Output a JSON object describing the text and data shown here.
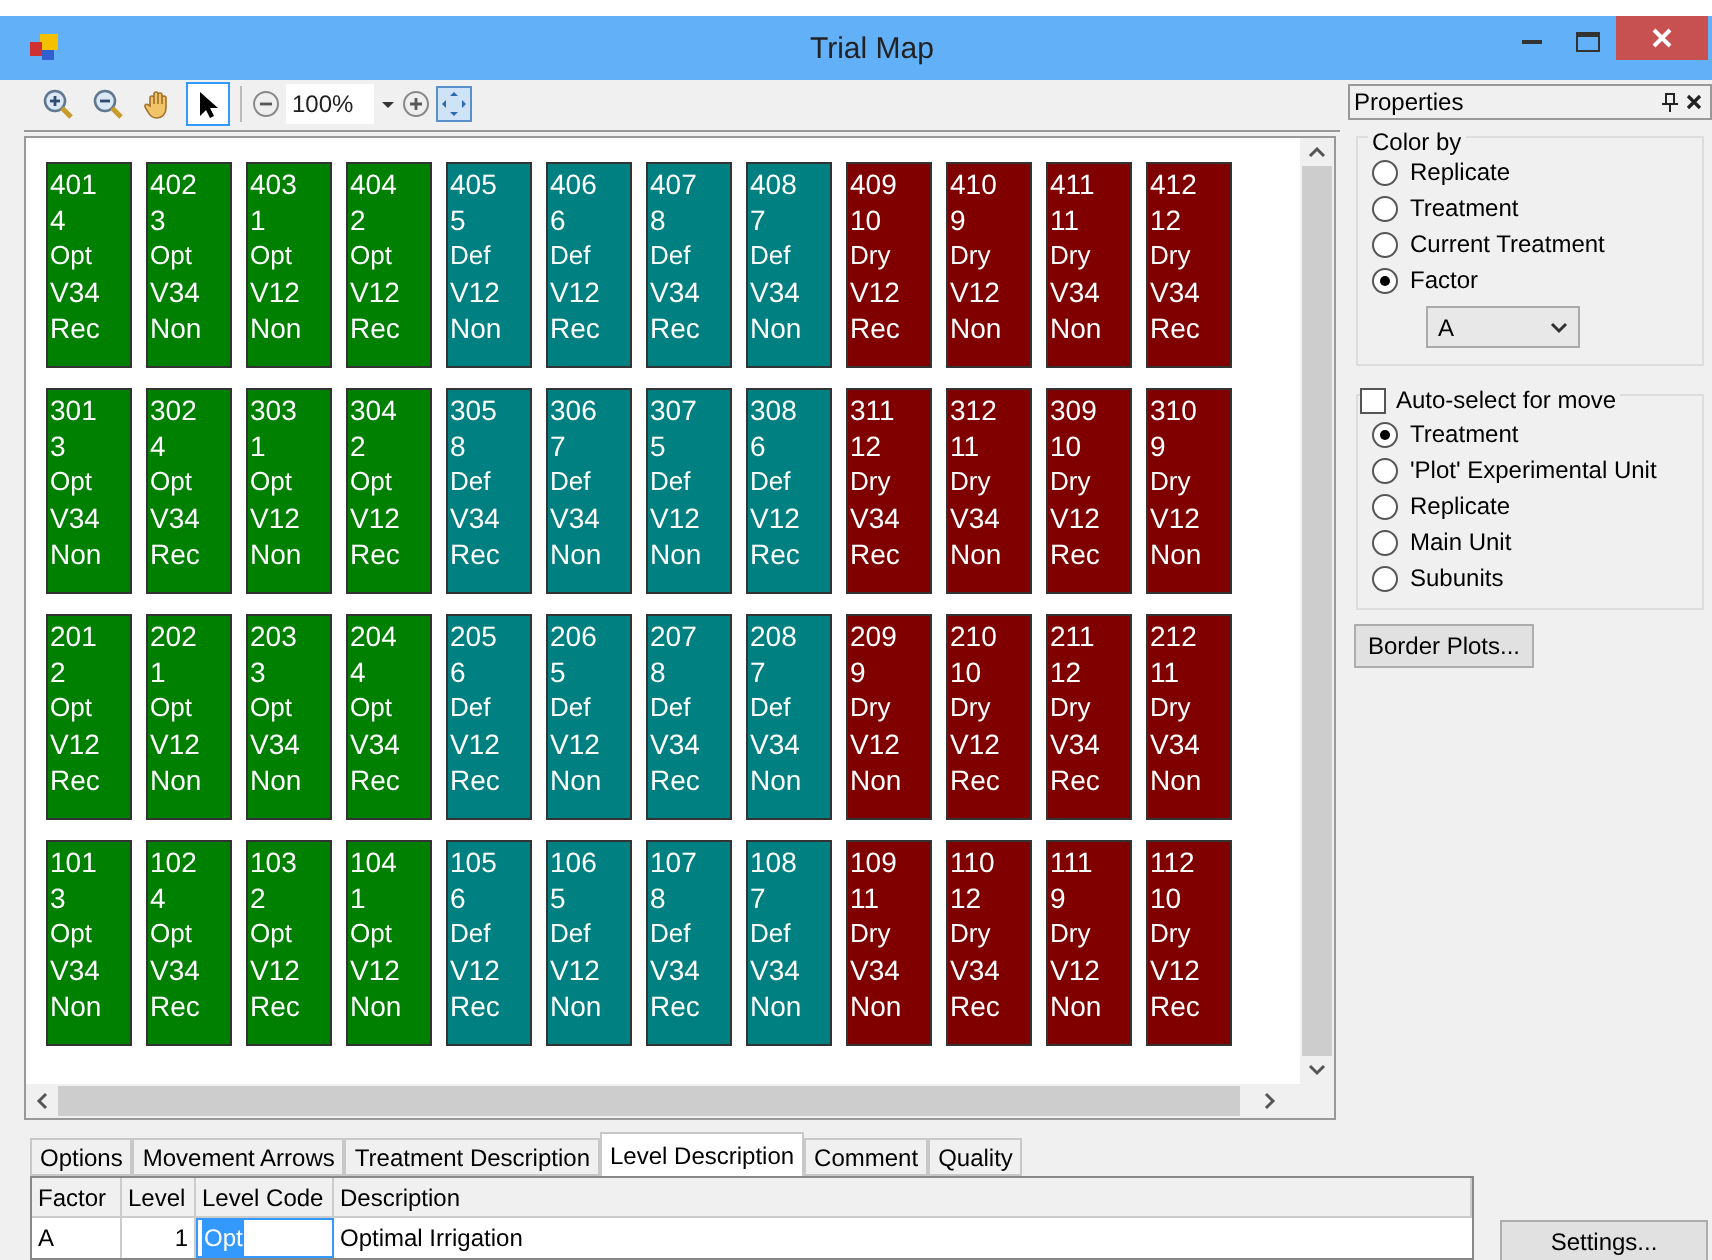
{
  "window": {
    "title": "Trial Map"
  },
  "toolbar": {
    "tools": [
      {
        "kind": "zoom-in",
        "selected": false
      },
      {
        "kind": "zoom-out",
        "selected": false
      },
      {
        "kind": "pan",
        "selected": false
      },
      {
        "kind": "pointer",
        "selected": true
      }
    ],
    "zoom": "100%"
  },
  "map": {
    "rows": [
      [
        {
          "plot": "401",
          "treatment": "4",
          "line_1": "Opt",
          "line_2": "V34",
          "line_3": "Rec",
          "color": "#008000"
        },
        {
          "plot": "402",
          "treatment": "3",
          "line_1": "Opt",
          "line_2": "V34",
          "line_3": "Non",
          "color": "#008000"
        },
        {
          "plot": "403",
          "treatment": "1",
          "line_1": "Opt",
          "line_2": "V12",
          "line_3": "Non",
          "color": "#008000"
        },
        {
          "plot": "404",
          "treatment": "2",
          "line_1": "Opt",
          "line_2": "V12",
          "line_3": "Rec",
          "color": "#008000"
        },
        {
          "plot": "405",
          "treatment": "5",
          "line_1": "Def",
          "line_2": "V12",
          "line_3": "Non",
          "color": "#008080"
        },
        {
          "plot": "406",
          "treatment": "6",
          "line_1": "Def",
          "line_2": "V12",
          "line_3": "Rec",
          "color": "#008080"
        },
        {
          "plot": "407",
          "treatment": "8",
          "line_1": "Def",
          "line_2": "V34",
          "line_3": "Rec",
          "color": "#008080"
        },
        {
          "plot": "408",
          "treatment": "7",
          "line_1": "Def",
          "line_2": "V34",
          "line_3": "Non",
          "color": "#008080"
        },
        {
          "plot": "409",
          "treatment": "10",
          "line_1": "Dry",
          "line_2": "V12",
          "line_3": "Rec",
          "color": "#800000"
        },
        {
          "plot": "410",
          "treatment": "9",
          "line_1": "Dry",
          "line_2": "V12",
          "line_3": "Non",
          "color": "#800000"
        },
        {
          "plot": "411",
          "treatment": "11",
          "line_1": "Dry",
          "line_2": "V34",
          "line_3": "Non",
          "color": "#800000"
        },
        {
          "plot": "412",
          "treatment": "12",
          "line_1": "Dry",
          "line_2": "V34",
          "line_3": "Rec",
          "color": "#800000"
        }
      ],
      [
        {
          "plot": "301",
          "treatment": "3",
          "line_1": "Opt",
          "line_2": "V34",
          "line_3": "Non",
          "color": "#008000"
        },
        {
          "plot": "302",
          "treatment": "4",
          "line_1": "Opt",
          "line_2": "V34",
          "line_3": "Rec",
          "color": "#008000"
        },
        {
          "plot": "303",
          "treatment": "1",
          "line_1": "Opt",
          "line_2": "V12",
          "line_3": "Non",
          "color": "#008000"
        },
        {
          "plot": "304",
          "treatment": "2",
          "line_1": "Opt",
          "line_2": "V12",
          "line_3": "Rec",
          "color": "#008000"
        },
        {
          "plot": "305",
          "treatment": "8",
          "line_1": "Def",
          "line_2": "V34",
          "line_3": "Rec",
          "color": "#008080"
        },
        {
          "plot": "306",
          "treatment": "7",
          "line_1": "Def",
          "line_2": "V34",
          "line_3": "Non",
          "color": "#008080"
        },
        {
          "plot": "307",
          "treatment": "5",
          "line_1": "Def",
          "line_2": "V12",
          "line_3": "Non",
          "color": "#008080"
        },
        {
          "plot": "308",
          "treatment": "6",
          "line_1": "Def",
          "line_2": "V12",
          "line_3": "Rec",
          "color": "#008080"
        },
        {
          "plot": "311",
          "treatment": "12",
          "line_1": "Dry",
          "line_2": "V34",
          "line_3": "Rec",
          "color": "#800000"
        },
        {
          "plot": "312",
          "treatment": "11",
          "line_1": "Dry",
          "line_2": "V34",
          "line_3": "Non",
          "color": "#800000"
        },
        {
          "plot": "309",
          "treatment": "10",
          "line_1": "Dry",
          "line_2": "V12",
          "line_3": "Rec",
          "color": "#800000"
        },
        {
          "plot": "310",
          "treatment": "9",
          "line_1": "Dry",
          "line_2": "V12",
          "line_3": "Non",
          "color": "#800000"
        }
      ],
      [
        {
          "plot": "201",
          "treatment": "2",
          "line_1": "Opt",
          "line_2": "V12",
          "line_3": "Rec",
          "color": "#008000"
        },
        {
          "plot": "202",
          "treatment": "1",
          "line_1": "Opt",
          "line_2": "V12",
          "line_3": "Non",
          "color": "#008000"
        },
        {
          "plot": "203",
          "treatment": "3",
          "line_1": "Opt",
          "line_2": "V34",
          "line_3": "Non",
          "color": "#008000"
        },
        {
          "plot": "204",
          "treatment": "4",
          "line_1": "Opt",
          "line_2": "V34",
          "line_3": "Rec",
          "color": "#008000"
        },
        {
          "plot": "205",
          "treatment": "6",
          "line_1": "Def",
          "line_2": "V12",
          "line_3": "Rec",
          "color": "#008080"
        },
        {
          "plot": "206",
          "treatment": "5",
          "line_1": "Def",
          "line_2": "V12",
          "line_3": "Non",
          "color": "#008080"
        },
        {
          "plot": "207",
          "treatment": "8",
          "line_1": "Def",
          "line_2": "V34",
          "line_3": "Rec",
          "color": "#008080"
        },
        {
          "plot": "208",
          "treatment": "7",
          "line_1": "Def",
          "line_2": "V34",
          "line_3": "Non",
          "color": "#008080"
        },
        {
          "plot": "209",
          "treatment": "9",
          "line_1": "Dry",
          "line_2": "V12",
          "line_3": "Non",
          "color": "#800000"
        },
        {
          "plot": "210",
          "treatment": "10",
          "line_1": "Dry",
          "line_2": "V12",
          "line_3": "Rec",
          "color": "#800000"
        },
        {
          "plot": "211",
          "treatment": "12",
          "line_1": "Dry",
          "line_2": "V34",
          "line_3": "Rec",
          "color": "#800000"
        },
        {
          "plot": "212",
          "treatment": "11",
          "line_1": "Dry",
          "line_2": "V34",
          "line_3": "Non",
          "color": "#800000"
        }
      ],
      [
        {
          "plot": "101",
          "treatment": "3",
          "line_1": "Opt",
          "line_2": "V34",
          "line_3": "Non",
          "color": "#008000"
        },
        {
          "plot": "102",
          "treatment": "4",
          "line_1": "Opt",
          "line_2": "V34",
          "line_3": "Rec",
          "color": "#008000"
        },
        {
          "plot": "103",
          "treatment": "2",
          "line_1": "Opt",
          "line_2": "V12",
          "line_3": "Rec",
          "color": "#008000"
        },
        {
          "plot": "104",
          "treatment": "1",
          "line_1": "Opt",
          "line_2": "V12",
          "line_3": "Non",
          "color": "#008000"
        },
        {
          "plot": "105",
          "treatment": "6",
          "line_1": "Def",
          "line_2": "V12",
          "line_3": "Rec",
          "color": "#008080"
        },
        {
          "plot": "106",
          "treatment": "5",
          "line_1": "Def",
          "line_2": "V12",
          "line_3": "Non",
          "color": "#008080"
        },
        {
          "plot": "107",
          "treatment": "8",
          "line_1": "Def",
          "line_2": "V34",
          "line_3": "Rec",
          "color": "#008080"
        },
        {
          "plot": "108",
          "treatment": "7",
          "line_1": "Def",
          "line_2": "V34",
          "line_3": "Non",
          "color": "#008080"
        },
        {
          "plot": "109",
          "treatment": "11",
          "line_1": "Dry",
          "line_2": "V34",
          "line_3": "Non",
          "color": "#800000"
        },
        {
          "plot": "110",
          "treatment": "12",
          "line_1": "Dry",
          "line_2": "V34",
          "line_3": "Rec",
          "color": "#800000"
        },
        {
          "plot": "111",
          "treatment": "9",
          "line_1": "Dry",
          "line_2": "V12",
          "line_3": "Non",
          "color": "#800000"
        },
        {
          "plot": "112",
          "treatment": "10",
          "line_1": "Dry",
          "line_2": "V12",
          "line_3": "Rec",
          "color": "#800000"
        }
      ]
    ]
  },
  "tabs": [
    {
      "label": "Options",
      "selected": false
    },
    {
      "label": "Movement Arrows",
      "selected": false
    },
    {
      "label": "Treatment Description",
      "selected": false
    },
    {
      "label": "Level Description",
      "selected": true
    },
    {
      "label": "Comment",
      "selected": false
    },
    {
      "label": "Quality",
      "selected": false
    }
  ],
  "table": {
    "columns": [
      "Factor",
      "Level",
      "Level Code",
      "Description"
    ],
    "rows": [
      {
        "factor": "A",
        "level": "1",
        "level_code": "Opt",
        "description": "Optimal Irrigation",
        "selected": true
      }
    ]
  },
  "properties": {
    "title": "Properties",
    "color_by": {
      "label": "Color by",
      "options": [
        {
          "label": "Replicate",
          "selected": false
        },
        {
          "label": "Treatment",
          "selected": false
        },
        {
          "label": "Current Treatment",
          "selected": false
        },
        {
          "label": "Factor",
          "selected": true
        }
      ],
      "factor_value": "A"
    },
    "auto_select": {
      "label": "Auto-select for move",
      "checked": false,
      "options": [
        {
          "label": "Treatment",
          "selected": true
        },
        {
          "label": "'Plot' Experimental Unit",
          "selected": false
        },
        {
          "label": "Replicate",
          "selected": false
        },
        {
          "label": "Main Unit",
          "selected": false
        },
        {
          "label": "Subunits",
          "selected": false
        }
      ]
    },
    "border_plots_button": "Border Plots..."
  },
  "settings_button": "Settings..."
}
